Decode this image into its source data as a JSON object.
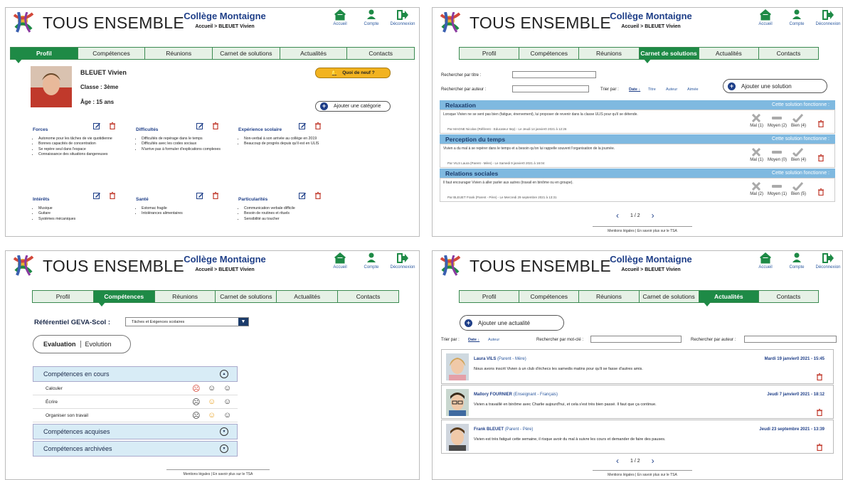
{
  "brand": {
    "logo_text": "TOUS ENSEMBLE",
    "school": "Collège Montaigne",
    "breadcrumb": "Accueil  >  BLEUET Vivien"
  },
  "top": {
    "home": "Accueil",
    "account": "Compte",
    "logout": "Déconnexion"
  },
  "tabs": [
    "Profil",
    "Compétences",
    "Réunions",
    "Carnet de solutions",
    "Actualités",
    "Contacts"
  ],
  "profile": {
    "name": "BLEUET Vivien",
    "class": "Classe : 3ème",
    "age": "Âge : 15 ans",
    "news_btn": "Quoi de neuf ?",
    "add_cat": "Ajouter une catégorie",
    "sections": [
      {
        "title": "Forces",
        "items": [
          "Autonome pour les tâches de vie quotidienne",
          "Bonnes capacités de concentration",
          "Se repère seul dans l'espace",
          "Connaissance des situations dangereuses"
        ]
      },
      {
        "title": "Difficultés",
        "items": [
          "Difficultés de repérage dans le temps",
          "Difficultés avec les codes sociaux",
          "N'arrive pas à formuler d'explications complexes"
        ]
      },
      {
        "title": "Expérience scolaire",
        "items": [
          "Non-verbal à son arrivée au collège en 2019",
          "Beaucoup de progrès depuis qu'il est en ULIS"
        ]
      },
      {
        "title": "Intérêts",
        "items": [
          "Musique",
          "Guitare",
          "Systèmes mécaniques"
        ]
      },
      {
        "title": "Santé",
        "items": [
          "Estomac fragile",
          "Intolérances alimentaires"
        ]
      },
      {
        "title": "Particularités",
        "items": [
          "Communication verbale difficile",
          "Besoin de routines et rituels",
          "Sensibilité au toucher"
        ]
      }
    ]
  },
  "solutions": {
    "search_title": "Rechercher par titre :",
    "search_author": "Rechercher par auteur :",
    "sort_label": "Trier par :",
    "sort": [
      "Date ↓",
      "Titre",
      "Auteur",
      "Aimée"
    ],
    "add": "Ajouter une solution",
    "works": "Cette solution fonctionne :",
    "items": [
      {
        "title": "Relaxation",
        "desc": "Lorsque Vivien ne se sent pas bien (fatigue, énervement), lui proposer de revenir dans la classe ULIS pour qu'il se détende.",
        "meta": "Par MAGNE Nicolas (Référent - Educateur Itep) - Le Jeudi 14 janvier0 2021 à 12:26",
        "bad": "Mal (1)",
        "mid": "Moyen (2)",
        "good": "Bien (4)"
      },
      {
        "title": "Perception du temps",
        "desc": "Vivien a du mal à se repérer dans le temps et a besoin qu'on lui rappelle souvent l'organisation de la journée.",
        "meta": "Par VILS Laura (Parent - Mère) - Le Samedi 9 janvier0 2021 à 16:04",
        "bad": "Mal (1)",
        "mid": "Moyen (0)",
        "good": "Bien (4)"
      },
      {
        "title": "Relations sociales",
        "desc": "Il faut encourager Vivien à aller parler aux autres (travail en binôme ou en groupe).",
        "meta": "Par BLEUET Frank (Parent - Père) - Le Mercredi 29 septembre 2021 à 13:31",
        "bad": "Mal (2)",
        "mid": "Moyen (1)",
        "good": "Bien (5)"
      }
    ],
    "page": "1 / 2"
  },
  "footer": "Mentions légales  |  En savoir plus sur le TSA",
  "competences": {
    "ref_label": "Référentiel GEVA-Scol :",
    "ref_value": "Tâches et Exigences scolaires",
    "seg": [
      "Evaluation",
      "Evolution"
    ],
    "current": "Compétences en cours",
    "rows": [
      "Calculer",
      "Écrire",
      "Organiser son travail"
    ],
    "acquired": "Compétences acquises",
    "archived": "Compétences archivées"
  },
  "news": {
    "add": "Ajouter une actualité",
    "sort_label": "Trier par :",
    "sort": [
      "Date ↓",
      "Auteur"
    ],
    "kw": "Rechercher par mot-clé :",
    "author": "Rechercher par auteur :",
    "items": [
      {
        "name": "Laura VILS",
        "role": "(Parent - Mère)",
        "date": "Mardi 19 janvier0 2021 - 15:45",
        "text": "Nous avons inscrit Vivien à un club d'échecs les samedis matins pour qu'il se fasse d'autres amis."
      },
      {
        "name": "Mallory FOURNIER",
        "role": "(Enseignant - Français)",
        "date": "Jeudi 7 janvier0 2021 - 18:12",
        "text": "Vivien a travaillé en binôme avec Charlie aujourd'hui, et cela s'est très bien passé. Il faut que ça continue."
      },
      {
        "name": "Frank BLEUET",
        "role": "(Parent - Père)",
        "date": "Jeudi 23 septembre 2021 - 13:39",
        "text": "Vivien est très fatigué cette semaine, il risque avoir du mal à suivre les cours et demander de faire des pauses."
      }
    ],
    "page": "1 / 2"
  },
  "colors": {
    "green": "#1e8a46",
    "navy": "#1f3f88",
    "blue_bar": "#7fb9e0",
    "yellow": "#f2b320"
  }
}
